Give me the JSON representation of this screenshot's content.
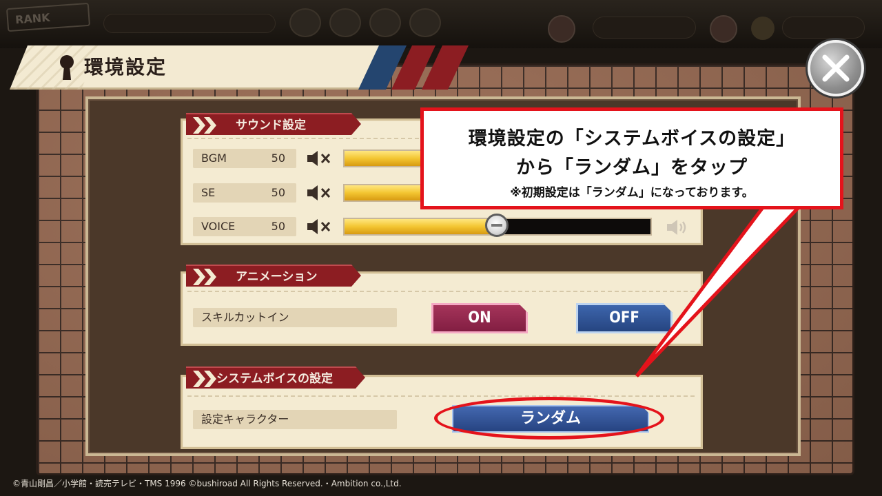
{
  "window": {
    "title": "環境設定"
  },
  "sound": {
    "section_title": "サウンド設定",
    "rows": [
      {
        "label": "BGM",
        "value": "50"
      },
      {
        "label": "SE",
        "value": "50"
      },
      {
        "label": "VOICE",
        "value": "50"
      }
    ]
  },
  "animation": {
    "section_title": "アニメーション",
    "row_label": "スキルカットイン",
    "on_label": "ON",
    "off_label": "OFF",
    "selected": "ON"
  },
  "system_voice": {
    "section_title": "システムボイスの設定",
    "row_label": "設定キャラクター",
    "value": "ランダム"
  },
  "callout": {
    "line1": "環境設定の「システムボイスの設定」",
    "line2": "から「ランダム」をタップ",
    "line3": "※初期設定は「ランダム」になっております。"
  },
  "footer": {
    "copyright": "©青山剛昌／小学館・読売テレビ・TMS 1996 ©bushiroad All Rights Reserved.・Ambition co.,Ltd."
  },
  "icons": {
    "close": "close-icon",
    "mute": "speaker-mute-icon",
    "keyhole": "keyhole-icon"
  },
  "colors": {
    "accent_red": "#e4131b",
    "section_red": "#8c1d22",
    "on_pink": "#a8365c",
    "off_blue": "#3f68b0"
  }
}
